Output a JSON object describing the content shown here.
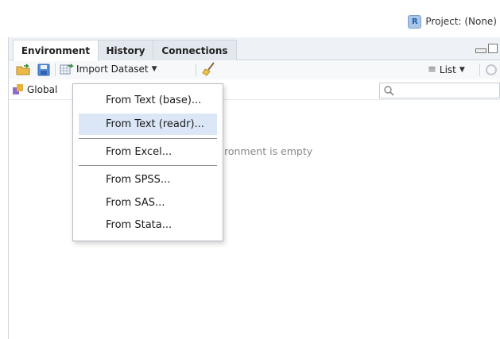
{
  "project": {
    "label": "Project: (None)",
    "icon": "r-project-icon",
    "icon_glyph": "R"
  },
  "tabs": [
    {
      "label": "Environment",
      "active": true
    },
    {
      "label": "History",
      "active": false
    },
    {
      "label": "Connections",
      "active": false
    }
  ],
  "toolbar": {
    "import_label": "Import Dataset",
    "list_label": "List"
  },
  "scope": {
    "label": "Global"
  },
  "search": {
    "placeholder": ""
  },
  "environment": {
    "empty_message": "ronment is empty"
  },
  "import_menu": {
    "items": [
      {
        "label": "From Text (base)...",
        "highlighted": false
      },
      {
        "label": "From Text (readr)...",
        "highlighted": true
      },
      {
        "label": "From Excel...",
        "highlighted": false
      },
      {
        "label": "From SPSS...",
        "highlighted": false
      },
      {
        "label": "From SAS...",
        "highlighted": false
      },
      {
        "label": "From Stata...",
        "highlighted": false
      }
    ]
  },
  "colors": {
    "highlight": "#dbe7f7",
    "tabbar": "#eef1f5",
    "accent": "#1f5fa8"
  }
}
